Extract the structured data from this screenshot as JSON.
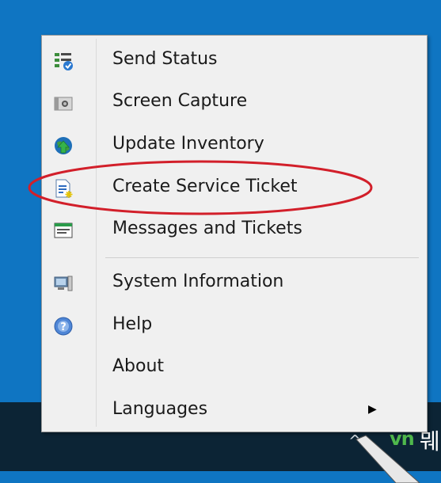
{
  "menu": {
    "items": [
      {
        "label": "Send Status",
        "icon": "send-status-icon"
      },
      {
        "label": "Screen Capture",
        "icon": "camera-icon"
      },
      {
        "label": "Update Inventory",
        "icon": "globe-update-icon"
      },
      {
        "label": "Create Service Ticket",
        "icon": "new-ticket-icon"
      },
      {
        "label": "Messages and Tickets",
        "icon": "messages-icon"
      },
      {
        "label": "System Information",
        "icon": "computer-icon"
      },
      {
        "label": "Help",
        "icon": "help-icon"
      },
      {
        "label": "About",
        "icon": ""
      },
      {
        "label": "Languages",
        "icon": "",
        "submenu_arrow": "▶"
      }
    ]
  },
  "tray": {
    "language_indicator": "vn",
    "glyph": "뭬",
    "overflow_caret": "^"
  },
  "colors": {
    "desktop": "#0f75c2",
    "taskbar": "#0c2435",
    "highlight_ellipse": "#d21f2a",
    "menu_background": "#f0f0f0"
  }
}
